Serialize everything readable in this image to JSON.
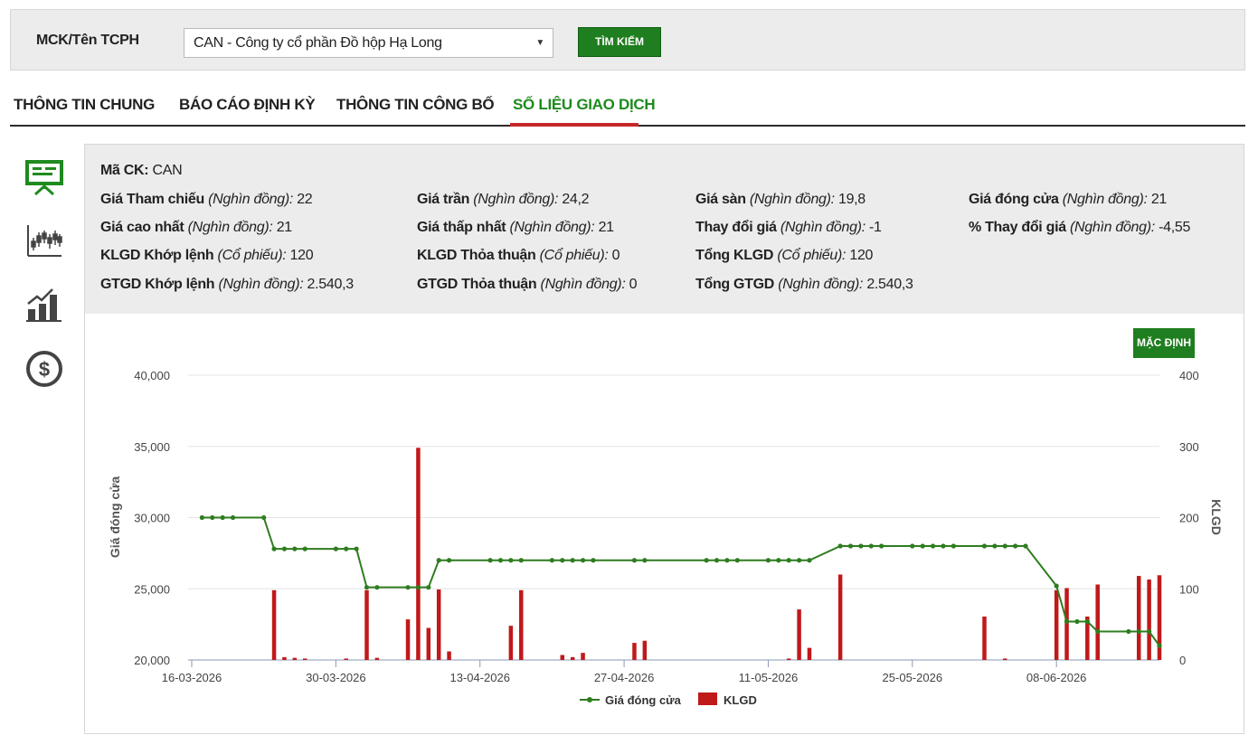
{
  "search": {
    "label": "MCK/Tên TCPH",
    "selected": "CAN - Công ty cổ phần Đồ hộp Hạ Long",
    "button": "TÌM KIẾM"
  },
  "tabs": [
    {
      "label": "THÔNG TIN CHUNG",
      "active": false
    },
    {
      "label": "BÁO CÁO ĐỊNH KỲ",
      "active": false
    },
    {
      "label": "THÔNG TIN CÔNG BỐ",
      "active": false
    },
    {
      "label": "SỐ LIỆU GIAO DỊCH",
      "active": true
    }
  ],
  "side_icons": [
    "presentation-board-icon",
    "candlestick-chart-icon",
    "bar-growth-chart-icon",
    "dollar-coin-icon"
  ],
  "info": {
    "ticker": {
      "label": "Mã CK:",
      "value": "CAN"
    },
    "fields": [
      {
        "label": "Giá Tham chiếu",
        "unit": "(Nghìn đồng):",
        "value": "22"
      },
      {
        "label": "Giá trần",
        "unit": "(Nghìn đồng):",
        "value": "24,2"
      },
      {
        "label": "Giá sàn",
        "unit": "(Nghìn đồng):",
        "value": "19,8"
      },
      {
        "label": "Giá đóng cửa",
        "unit": "(Nghìn đồng):",
        "value": "21"
      },
      {
        "label": "Giá cao nhất",
        "unit": "(Nghìn đồng):",
        "value": "21"
      },
      {
        "label": "Giá thấp nhất",
        "unit": "(Nghìn đồng):",
        "value": "21"
      },
      {
        "label": "Thay đổi giá",
        "unit": "(Nghìn đồng):",
        "value": "-1"
      },
      {
        "label": "% Thay đổi giá",
        "unit": "(Nghìn đồng):",
        "value": "-4,55"
      },
      {
        "label": "KLGD Khớp lệnh",
        "unit": "(Cổ phiếu):",
        "value": "120"
      },
      {
        "label": "KLGD Thỏa thuận",
        "unit": "(Cổ phiếu):",
        "value": "0"
      },
      {
        "label": "Tổng KLGD",
        "unit": "(Cổ phiếu):",
        "value": "120"
      },
      {
        "label": "GTGD Khớp lệnh",
        "unit": "(Nghìn đồng):",
        "value": "2.540,3"
      },
      {
        "label": "GTGD Thỏa thuận",
        "unit": "(Nghìn đồng):",
        "value": "0"
      },
      {
        "label": "Tổng GTGD",
        "unit": "(Nghìn đồng):",
        "value": "2.540,3"
      }
    ]
  },
  "chart_controls": {
    "default_button": "MẶC ĐỊNH"
  },
  "colors": {
    "accent_green": "#1f7e1f",
    "line": "#2e7d1f",
    "bar": "#c0191a",
    "active_tab_underline": "#c62828"
  },
  "chart_data": {
    "type": "bar+line",
    "title": "",
    "ylabel_left": "Giá đóng cửa",
    "ylabel_right": "KLGD",
    "ylim_left": [
      20000,
      40000
    ],
    "ylim_right": [
      0,
      400
    ],
    "yticks_left": [
      "20,000",
      "25,000",
      "30,000",
      "35,000",
      "40,000"
    ],
    "yticks_right": [
      "0",
      "100",
      "200",
      "300",
      "400"
    ],
    "xlim": [
      "2026-03-16",
      "2026-06-18"
    ],
    "xticks": [
      "16-03-2026",
      "30-03-2026",
      "13-04-2026",
      "27-04-2026",
      "11-05-2026",
      "25-05-2026",
      "08-06-2026"
    ],
    "legend": [
      {
        "name": "Giá đóng cửa",
        "kind": "line"
      },
      {
        "name": "KLGD",
        "kind": "bar"
      }
    ],
    "legend_position": "bottom",
    "grid": true,
    "line_series": {
      "name": "Giá đóng cửa",
      "points": [
        [
          "2026-03-17",
          30000
        ],
        [
          "2026-03-18",
          30000
        ],
        [
          "2026-03-19",
          30000
        ],
        [
          "2026-03-20",
          30000
        ],
        [
          "2026-03-23",
          30000
        ],
        [
          "2026-03-24",
          27800
        ],
        [
          "2026-03-25",
          27800
        ],
        [
          "2026-03-26",
          27800
        ],
        [
          "2026-03-27",
          27800
        ],
        [
          "2026-03-30",
          27800
        ],
        [
          "2026-03-31",
          27800
        ],
        [
          "2026-04-01",
          27800
        ],
        [
          "2026-04-02",
          25100
        ],
        [
          "2026-04-03",
          25100
        ],
        [
          "2026-04-06",
          25100
        ],
        [
          "2026-04-07",
          25100
        ],
        [
          "2026-04-08",
          25100
        ],
        [
          "2026-04-09",
          27000
        ],
        [
          "2026-04-10",
          27000
        ],
        [
          "2026-04-14",
          27000
        ],
        [
          "2026-04-15",
          27000
        ],
        [
          "2026-04-16",
          27000
        ],
        [
          "2026-04-17",
          27000
        ],
        [
          "2026-04-20",
          27000
        ],
        [
          "2026-04-21",
          27000
        ],
        [
          "2026-04-22",
          27000
        ],
        [
          "2026-04-23",
          27000
        ],
        [
          "2026-04-24",
          27000
        ],
        [
          "2026-04-28",
          27000
        ],
        [
          "2026-04-29",
          27000
        ],
        [
          "2026-05-05",
          27000
        ],
        [
          "2026-05-06",
          27000
        ],
        [
          "2026-05-07",
          27000
        ],
        [
          "2026-05-08",
          27000
        ],
        [
          "2026-05-11",
          27000
        ],
        [
          "2026-05-12",
          27000
        ],
        [
          "2026-05-13",
          27000
        ],
        [
          "2026-05-14",
          27000
        ],
        [
          "2026-05-15",
          27000
        ],
        [
          "2026-05-18",
          28000
        ],
        [
          "2026-05-19",
          28000
        ],
        [
          "2026-05-20",
          28000
        ],
        [
          "2026-05-21",
          28000
        ],
        [
          "2026-05-22",
          28000
        ],
        [
          "2026-05-25",
          28000
        ],
        [
          "2026-05-26",
          28000
        ],
        [
          "2026-05-27",
          28000
        ],
        [
          "2026-05-28",
          28000
        ],
        [
          "2026-05-29",
          28000
        ],
        [
          "2026-06-01",
          28000
        ],
        [
          "2026-06-02",
          28000
        ],
        [
          "2026-06-03",
          28000
        ],
        [
          "2026-06-04",
          28000
        ],
        [
          "2026-06-05",
          28000
        ],
        [
          "2026-06-08",
          25200
        ],
        [
          "2026-06-09",
          22700
        ],
        [
          "2026-06-10",
          22700
        ],
        [
          "2026-06-11",
          22700
        ],
        [
          "2026-06-12",
          22000
        ],
        [
          "2026-06-15",
          22000
        ],
        [
          "2026-06-16",
          22000
        ],
        [
          "2026-06-17",
          22000
        ],
        [
          "2026-06-18",
          21000
        ]
      ]
    },
    "bar_series": {
      "name": "KLGD",
      "points": [
        [
          "2026-03-24",
          98
        ],
        [
          "2026-03-25",
          4
        ],
        [
          "2026-03-26",
          3
        ],
        [
          "2026-03-27",
          2
        ],
        [
          "2026-03-31",
          2
        ],
        [
          "2026-04-02",
          98
        ],
        [
          "2026-04-03",
          3
        ],
        [
          "2026-04-06",
          57
        ],
        [
          "2026-04-07",
          298
        ],
        [
          "2026-04-08",
          45
        ],
        [
          "2026-04-09",
          99
        ],
        [
          "2026-04-10",
          12
        ],
        [
          "2026-04-16",
          48
        ],
        [
          "2026-04-17",
          98
        ],
        [
          "2026-04-21",
          7
        ],
        [
          "2026-04-22",
          4
        ],
        [
          "2026-04-23",
          10
        ],
        [
          "2026-04-28",
          24
        ],
        [
          "2026-04-29",
          27
        ],
        [
          "2026-05-13",
          2
        ],
        [
          "2026-05-14",
          71
        ],
        [
          "2026-05-15",
          17
        ],
        [
          "2026-05-18",
          120
        ],
        [
          "2026-06-01",
          61
        ],
        [
          "2026-06-03",
          2
        ],
        [
          "2026-06-08",
          98
        ],
        [
          "2026-06-09",
          101
        ],
        [
          "2026-06-11",
          61
        ],
        [
          "2026-06-12",
          106
        ],
        [
          "2026-06-16",
          118
        ],
        [
          "2026-06-17",
          113
        ],
        [
          "2026-06-18",
          119
        ]
      ]
    }
  }
}
